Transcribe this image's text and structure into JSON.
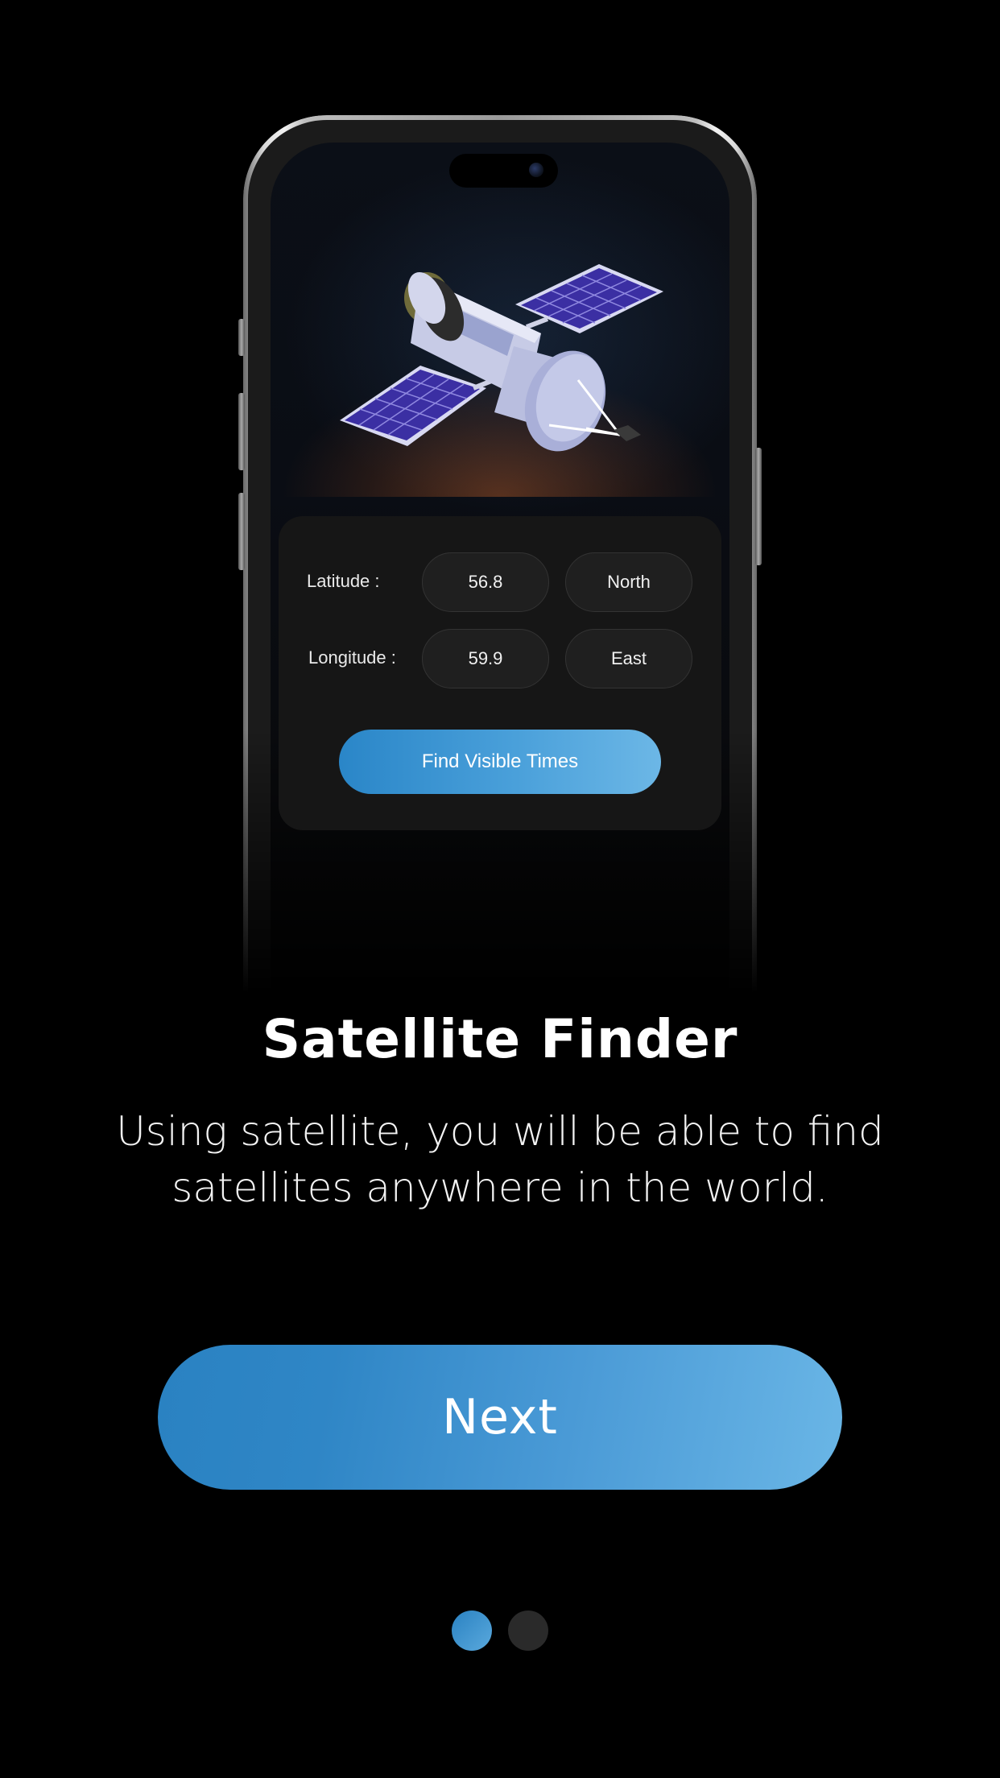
{
  "form": {
    "latitude_label": "Latitude :",
    "latitude_value": "56.8",
    "latitude_direction": "North",
    "longitude_label": "Longitude :",
    "longitude_value": "59.9",
    "longitude_direction": "East",
    "find_button_label": "Find Visible Times"
  },
  "onboarding": {
    "title": "Satellite Finder",
    "description": "Using satellite, you will be able to find satellites anywhere in the world.",
    "next_button_label": "Next"
  },
  "pager": {
    "total_pages": 2,
    "active_index": 0
  },
  "colors": {
    "background": "#000000",
    "accent_start": "#2a82c2",
    "accent_end": "#6ab6e6",
    "card": "#161616",
    "pill": "#1f1f1f",
    "inactive_dot": "#2a2a2a"
  },
  "icons": {
    "illustration": "satellite-icon",
    "camera": "camera-icon"
  }
}
